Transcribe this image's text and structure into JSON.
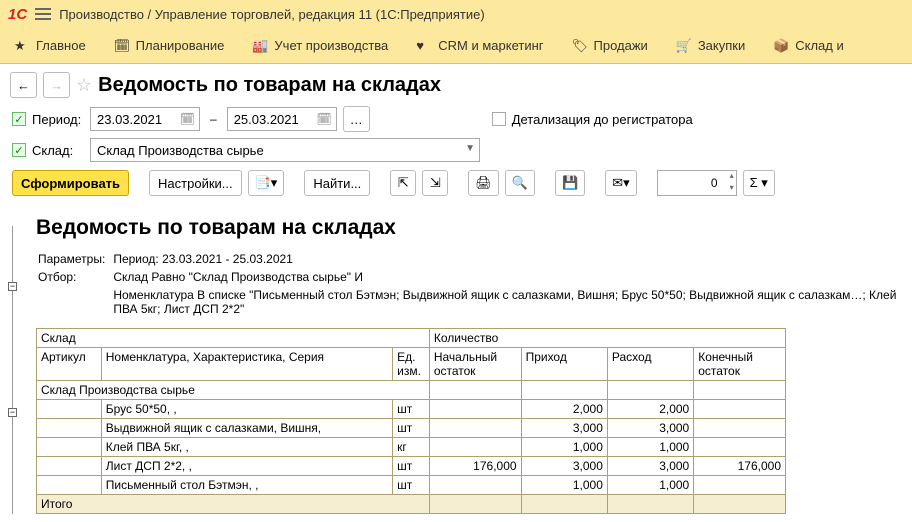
{
  "app_title": "Производство / Управление торговлей, редакция 11  (1С:Предприятие)",
  "menu": [
    "Главное",
    "Планирование",
    "Учет производства",
    "CRM и маркетинг",
    "Продажи",
    "Закупки",
    "Склад и"
  ],
  "page_title": "Ведомость по товарам на складах",
  "period_label": "Период:",
  "date_from": "23.03.2021",
  "date_sep": "–",
  "date_to": "25.03.2021",
  "detail_label": "Детализация до регистратора",
  "sklad_label": "Склад:",
  "sklad_value": "Склад Производства сырье",
  "btn_form": "Сформировать",
  "btn_settings": "Настройки...",
  "btn_find": "Найти...",
  "spin_value": "0",
  "rpt_title": "Ведомость по товарам на складах",
  "params_label": "Параметры:",
  "params_value": "Период: 23.03.2021 - 25.03.2021",
  "otbor_label": "Отбор:",
  "otbor_line1": "Склад Равно \"Склад Производства сырье\" И",
  "otbor_line2": "Номенклатура В списке \"Письменный стол Бэтмэн; Выдвижной ящик с салазками, Вишня; Брус 50*50; Выдвижной ящик с салазкам…; Клей ПВА 5кг; Лист ДСП 2*2\"",
  "tbl": {
    "hdr_sklad": "Склад",
    "hdr_kol": "Количество",
    "hdr_art": "Артикул",
    "hdr_nom": "Номенклатура, Характеристика, Серия",
    "hdr_ed": "Ед. изм.",
    "hdr_nach": "Начальный остаток",
    "hdr_prih": "Приход",
    "hdr_rash": "Расход",
    "hdr_kon": "Конечный остаток",
    "group": "Склад Производства сырье",
    "rows": [
      {
        "nom": "Брус 50*50, ,",
        "ed": "шт",
        "nach": "",
        "prih": "2,000",
        "rash": "2,000",
        "kon": ""
      },
      {
        "nom": "Выдвижной ящик с салазками, Вишня,",
        "ed": "шт",
        "nach": "",
        "prih": "3,000",
        "rash": "3,000",
        "kon": ""
      },
      {
        "nom": "Клей ПВА 5кг, ,",
        "ed": "кг",
        "nach": "",
        "prih": "1,000",
        "rash": "1,000",
        "kon": ""
      },
      {
        "nom": "Лист ДСП 2*2, ,",
        "ed": "шт",
        "nach": "176,000",
        "prih": "3,000",
        "rash": "3,000",
        "kon": "176,000"
      },
      {
        "nom": "Письменный стол Бэтмэн, ,",
        "ed": "шт",
        "nach": "",
        "prih": "1,000",
        "rash": "1,000",
        "kon": ""
      }
    ],
    "totals_label": "Итого"
  }
}
